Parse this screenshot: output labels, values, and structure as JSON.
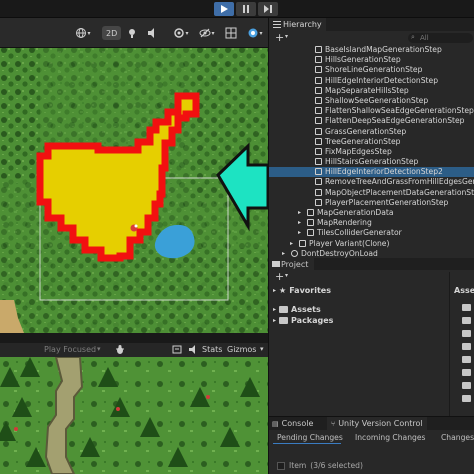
{
  "colors": {
    "grass": "#4d8f35",
    "tree": "#2a5a1e",
    "outline_red": "#f21010",
    "fill_yellow": "#e6cf00",
    "arrow_cyan": "#1de3c2",
    "water": "#3aa0d8",
    "selection": "#2c5d87"
  },
  "toolbar": {
    "play_icon": "play-icon",
    "pause_icon": "pause-icon",
    "step_icon": "step-icon"
  },
  "scene": {
    "mode_2d": "2D",
    "icons": [
      "globe-icon",
      "hand-icon",
      "layers-icon",
      "eye-off-icon",
      "grid-icon",
      "gizmo-icon"
    ]
  },
  "game": {
    "play_focused": "Play Focused",
    "stats": "Stats",
    "gizmos": "Gizmos"
  },
  "hierarchy": {
    "tab_label": "Hierarchy",
    "add": "+",
    "search_placeholder": "All",
    "items": [
      {
        "label": "BaseIslandMapGenerationStep",
        "indent": 3
      },
      {
        "label": "HillsGenerationStep",
        "indent": 3
      },
      {
        "label": "ShoreLineGenerationStep",
        "indent": 3
      },
      {
        "label": "HillEdgeInteriorDetectionStep",
        "indent": 3
      },
      {
        "label": "MapSeparateHillsStep",
        "indent": 3
      },
      {
        "label": "ShallowSeeGenerationStep",
        "indent": 3
      },
      {
        "label": "FlattenShallowSeaEdgeGenerationStep",
        "indent": 3
      },
      {
        "label": "FlattenDeepSeaEdgeGenerationStep",
        "indent": 3
      },
      {
        "label": "GrassGenerationStep",
        "indent": 3
      },
      {
        "label": "TreeGenerationStep",
        "indent": 3
      },
      {
        "label": "FixMapEdgesStep",
        "indent": 3
      },
      {
        "label": "HillStairsGenerationStep",
        "indent": 3
      },
      {
        "label": "HillEdgeInteriorDetectionStep2",
        "indent": 3,
        "selected": true
      },
      {
        "label": "RemoveTreeAndGrassFromHillEdgesGen",
        "indent": 3
      },
      {
        "label": "MapObjectPlacementDataGenerationSte",
        "indent": 3
      },
      {
        "label": "PlayerPlacementGenerationStep",
        "indent": 3
      },
      {
        "label": "MapGenerationData",
        "indent": 2
      },
      {
        "label": "MapRendering",
        "indent": 2
      },
      {
        "label": "TilesColliderGenerator",
        "indent": 2
      },
      {
        "label": "Player Variant(Clone)",
        "indent": 1
      },
      {
        "label": "DontDestroyOnLoad",
        "indent": 0
      }
    ]
  },
  "project": {
    "tab_label": "Project",
    "add": "+",
    "favorites": "Favorites",
    "assets": "Assets",
    "packages": "Packages",
    "right_assets": "Asse"
  },
  "console": {
    "tab_console": "Console",
    "tab_uvc": "Unity Version Control",
    "pending": "Pending Changes",
    "incoming": "Incoming Changes",
    "changesets": "Changes",
    "item_text": "Item",
    "selected_text": "(3/6 selected)"
  }
}
